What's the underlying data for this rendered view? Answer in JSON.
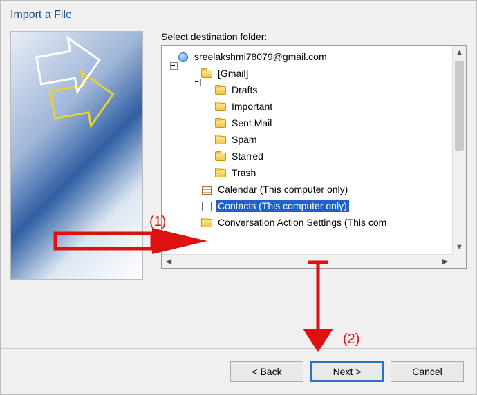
{
  "dialog": {
    "title": "Import a File",
    "label": "Select destination folder:"
  },
  "tree": {
    "account": "sreelakshmi78079@gmail.com",
    "gmail_label": "[Gmail]",
    "folders": {
      "drafts": "Drafts",
      "important": "Important",
      "sentmail": "Sent Mail",
      "spam": "Spam",
      "starred": "Starred",
      "trash": "Trash"
    },
    "calendar": "Calendar (This computer only)",
    "contacts": "Contacts (This computer only)",
    "conversation": "Conversation Action Settings (This com"
  },
  "buttons": {
    "back": "<  Back",
    "next": "Next  >",
    "cancel": "Cancel"
  },
  "annotations": {
    "one": "(1)",
    "two": "(2)"
  }
}
